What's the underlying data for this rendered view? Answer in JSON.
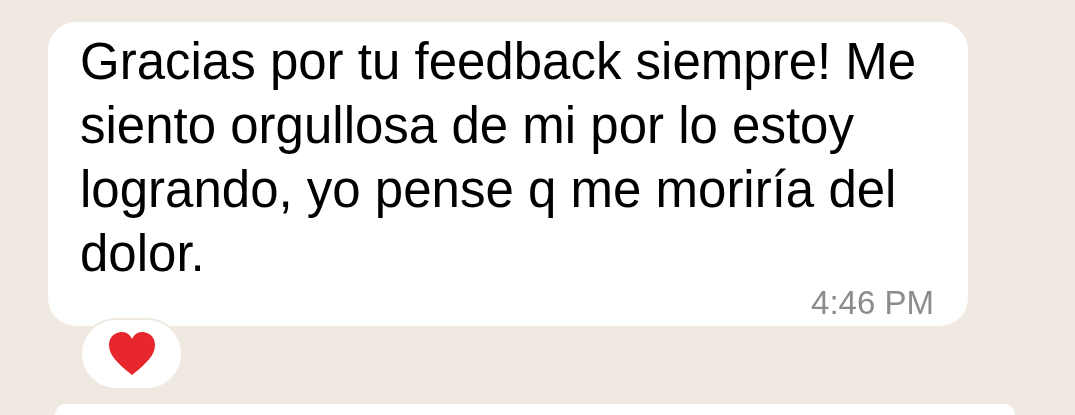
{
  "message": {
    "text": "Gracias por tu feedback siempre! Me siento orgullosa de mi por lo estoy logrando, yo pense q me moriría del dolor.",
    "time": "4:46 PM",
    "reaction": {
      "kind": "heart"
    }
  }
}
